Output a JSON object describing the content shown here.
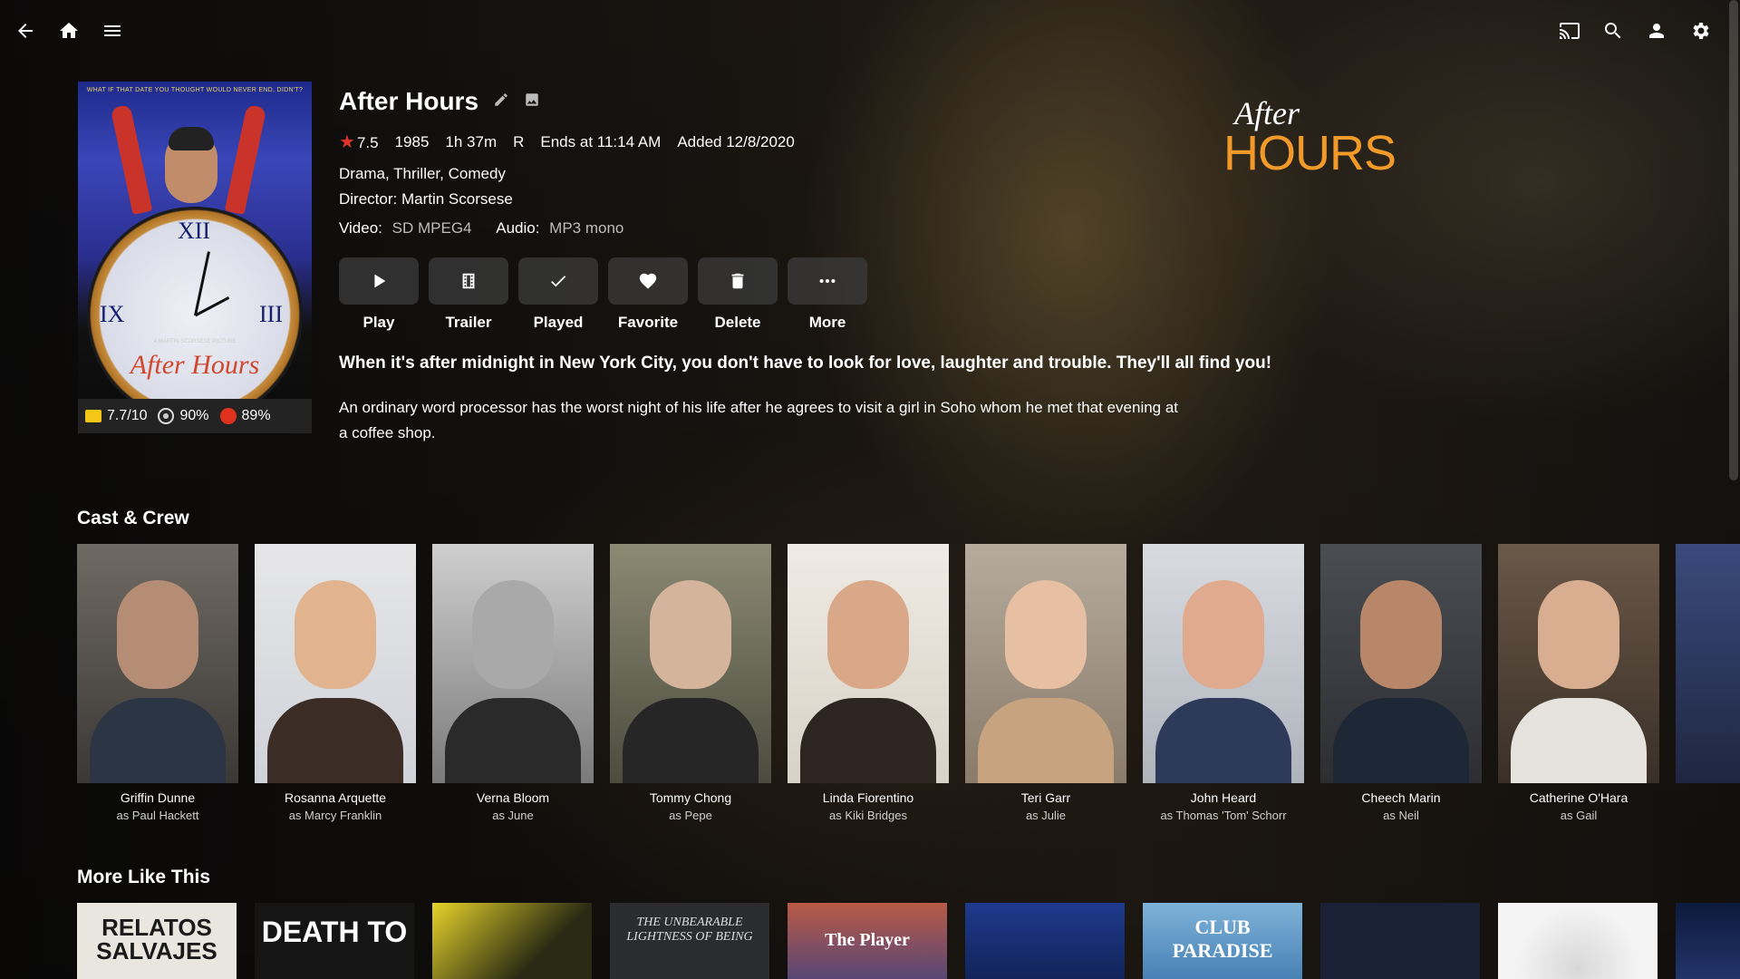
{
  "movie": {
    "title": "After Hours",
    "community_rating": "7.5",
    "year": "1985",
    "runtime": "1h 37m",
    "official_rating": "R",
    "ends_at": "Ends at 11:14 AM",
    "added": "Added 12/8/2020",
    "genres": "Drama, Thriller, Comedy",
    "director": "Director: Martin Scorsese",
    "video_label": "Video:",
    "video_value": "SD MPEG4",
    "audio_label": "Audio:",
    "audio_value": "MP3 mono",
    "tagline": "When it's after midnight in New York City, you don't have to look for love, laughter and trouble. They'll all find you!",
    "overview": "An ordinary word processor has the worst night of his life after he agrees to visit a girl in Soho whom he met that evening at a coffee shop."
  },
  "poster": {
    "tagline": "WHAT IF THAT DATE YOU THOUGHT WOULD NEVER END, DIDN'T?",
    "credit": "A MARTIN SCORSESE PICTURE",
    "title": "After Hours",
    "clock_numerals": [
      "XII",
      "IX",
      "III"
    ]
  },
  "ratings": {
    "imdb": "7.7/10",
    "critic": "90%",
    "tomato": "89%"
  },
  "logo": {
    "after": "After",
    "hours": "HOURS"
  },
  "actions": [
    {
      "label": "Play",
      "icon": "play-icon"
    },
    {
      "label": "Trailer",
      "icon": "film-icon"
    },
    {
      "label": "Played",
      "icon": "check-icon"
    },
    {
      "label": "Favorite",
      "icon": "heart-icon"
    },
    {
      "label": "Delete",
      "icon": "trash-icon"
    },
    {
      "label": "More",
      "icon": "more-dots-icon"
    }
  ],
  "sections": {
    "cast": "Cast & Crew",
    "more": "More Like This"
  },
  "cast": [
    {
      "name": "Griffin Dunne",
      "role": "as Paul Hackett"
    },
    {
      "name": "Rosanna Arquette",
      "role": "as Marcy Franklin"
    },
    {
      "name": "Verna Bloom",
      "role": "as June"
    },
    {
      "name": "Tommy Chong",
      "role": "as Pepe"
    },
    {
      "name": "Linda Fiorentino",
      "role": "as Kiki Bridges"
    },
    {
      "name": "Teri Garr",
      "role": "as Julie"
    },
    {
      "name": "John Heard",
      "role": "as Thomas 'Tom' Schorr"
    },
    {
      "name": "Cheech Marin",
      "role": "as Neil"
    },
    {
      "name": "Catherine O'Hara",
      "role": "as Gail"
    }
  ],
  "more_like_this": [
    {
      "text": "RELATOS SALVAJES"
    },
    {
      "text": "DEATH TO"
    },
    {
      "text": ""
    },
    {
      "text": "THE UNBEARABLE LIGHTNESS OF BEING"
    },
    {
      "text": "The Player"
    },
    {
      "text": ""
    },
    {
      "text": "CLUB PARADISE"
    },
    {
      "text": ""
    },
    {
      "text": ""
    },
    {
      "text": ""
    }
  ],
  "colors": {
    "accent_star": "#e0342a",
    "logo_orange": "#f19a2a"
  }
}
